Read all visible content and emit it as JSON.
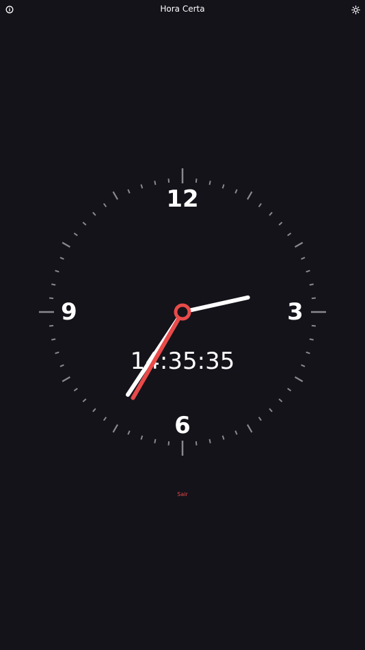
{
  "header": {
    "title": "Hora Certa",
    "info_icon": "info-icon",
    "theme_icon": "sun-icon"
  },
  "clock": {
    "numerals": {
      "twelve": "12",
      "three": "3",
      "six": "6",
      "nine": "9"
    },
    "digital_time": "14:35:35",
    "time": {
      "hours": 14,
      "minutes": 35,
      "seconds": 35
    },
    "colors": {
      "background": "#14131a",
      "hands": "#ffffff",
      "second_hand": "#e84a4a",
      "ticks": "#8a8a8e"
    }
  },
  "footer": {
    "exit_label": "Sair"
  }
}
